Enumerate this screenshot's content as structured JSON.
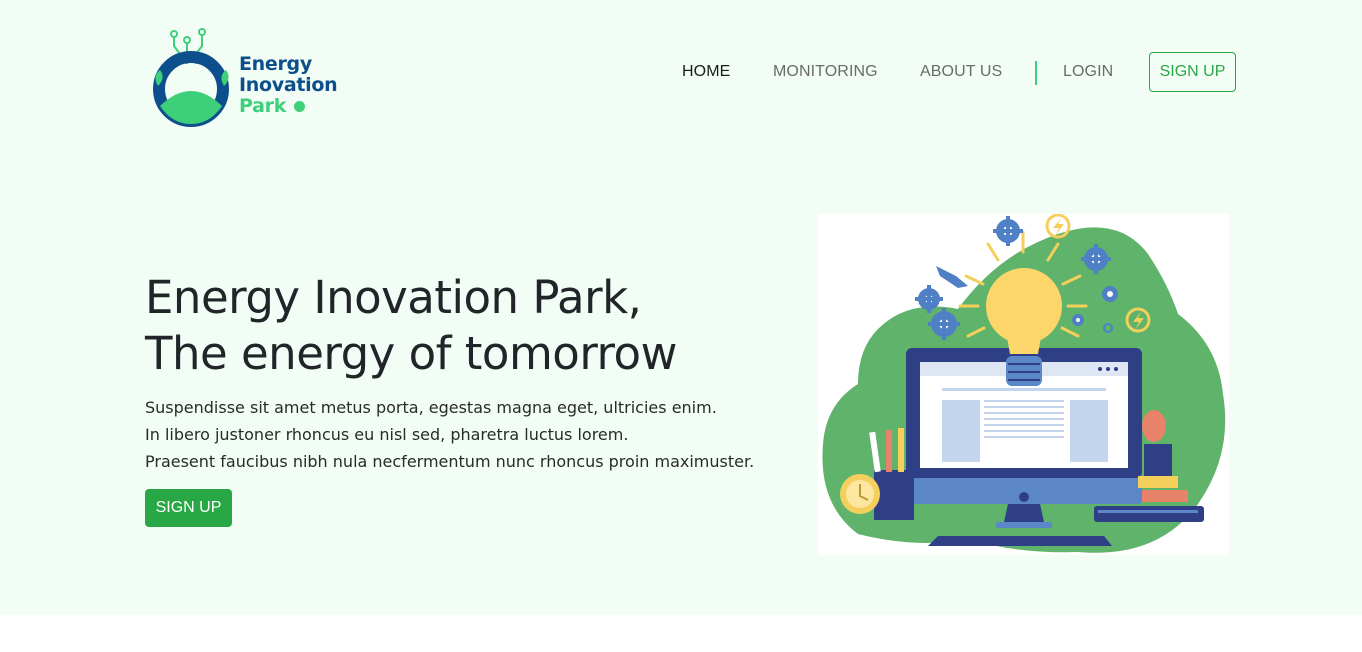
{
  "brand": {
    "line1": "Energy",
    "line2": "Inovation",
    "line3": "Park"
  },
  "nav": {
    "home": "HOME",
    "monitoring": "MONITORING",
    "about": "ABOUT US",
    "login": "LOGIN",
    "signup": "SIGN UP"
  },
  "hero": {
    "title_line1": "Energy Inovation Park,",
    "title_line2": "The energy of tomorrow",
    "body_line1": "Suspendisse sit amet metus porta, egestas magna eget, ultricies enim.",
    "body_line2": "In libero justoner rhoncus eu nisl sed, pharetra luctus lorem.",
    "body_line3": "Praesent faucibus nibh nula necfermentum nunc rhoncus proin maximuster.",
    "cta": "SIGN UP"
  },
  "colors": {
    "brand_blue": "#0d4f8c",
    "brand_green": "#3ecf7a",
    "button_green": "#28a745",
    "hero_bg": "#f2fdf5"
  },
  "icons": {
    "logo": "energy-park-logo-icon",
    "illustration": "idea-computer-illustration"
  }
}
